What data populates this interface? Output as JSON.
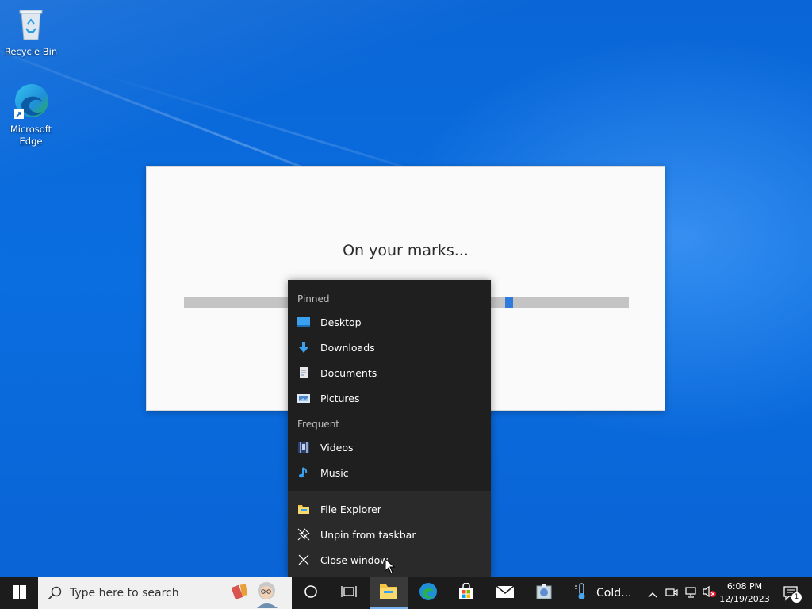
{
  "desktop": {
    "icons": [
      {
        "label": "Recycle Bin",
        "icon": "recycle-bin-icon"
      },
      {
        "label": "Microsoft Edge",
        "icon": "edge-icon"
      }
    ]
  },
  "dialog": {
    "title": "On your marks...",
    "progress_fraction": 0.73
  },
  "jumplist": {
    "pinned_header": "Pinned",
    "pinned": [
      {
        "label": "Desktop",
        "icon": "desktop-folder-icon"
      },
      {
        "label": "Downloads",
        "icon": "downloads-folder-icon"
      },
      {
        "label": "Documents",
        "icon": "documents-folder-icon"
      },
      {
        "label": "Pictures",
        "icon": "pictures-folder-icon"
      }
    ],
    "frequent_header": "Frequent",
    "frequent": [
      {
        "label": "Videos",
        "icon": "videos-folder-icon"
      },
      {
        "label": "Music",
        "icon": "music-folder-icon"
      }
    ],
    "tasks": [
      {
        "label": "File Explorer",
        "icon": "file-explorer-icon"
      },
      {
        "label": "Unpin from taskbar",
        "icon": "unpin-icon"
      },
      {
        "label": "Close window",
        "icon": "close-icon"
      }
    ]
  },
  "taskbar": {
    "search_placeholder": "Type here to search",
    "weather_text": "Cold...",
    "time": "6:08 PM",
    "date": "12/19/2023",
    "notification_count": "1"
  },
  "colors": {
    "accent": "#2f7bdb",
    "desktop_bg": "#0a66d6",
    "jumplist_bg": "#1f1f1f",
    "taskbar_bg": "#1c1c1c"
  }
}
